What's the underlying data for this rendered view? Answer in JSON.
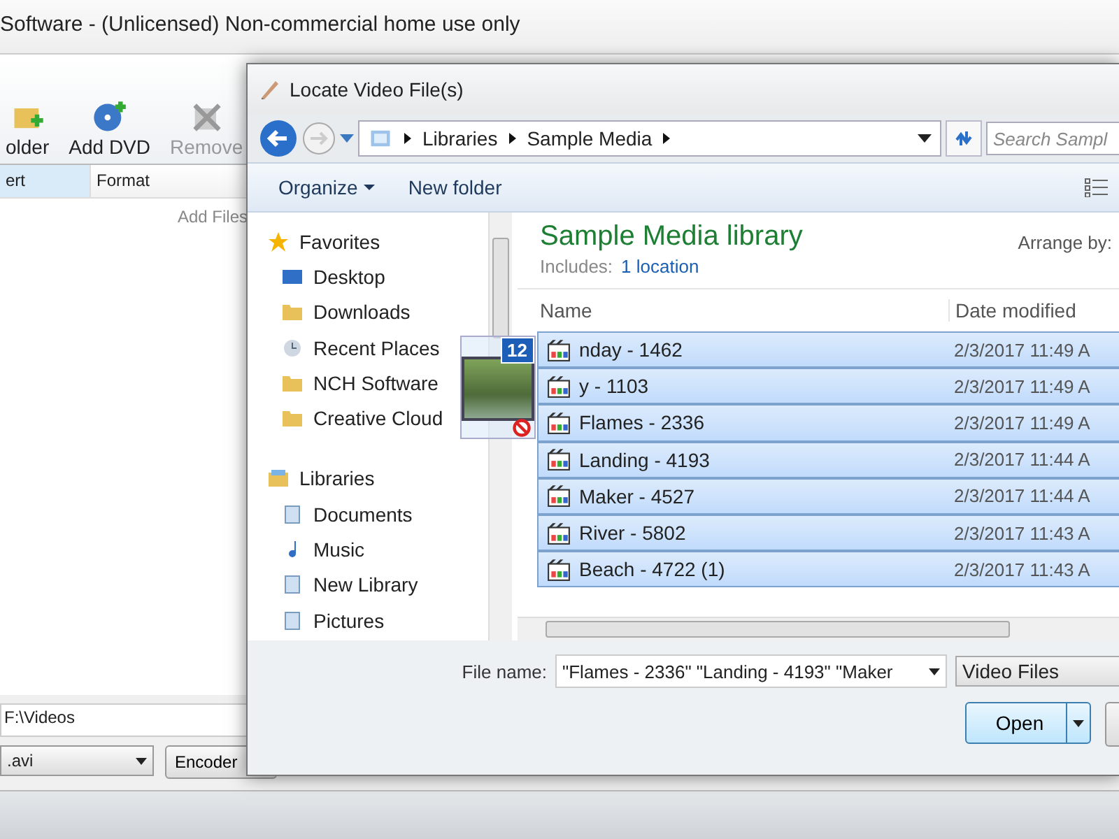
{
  "app": {
    "title": "Software - (Unlicensed) Non-commercial home use only",
    "toolbar": [
      {
        "label": "older",
        "disabled": false
      },
      {
        "label": "Add DVD",
        "disabled": false
      },
      {
        "label": "Remove",
        "disabled": true
      }
    ],
    "columns": [
      "ert",
      "Format"
    ],
    "empty_hint": "Add Files",
    "output_folder": "F:\\Videos",
    "format": ".avi",
    "encoder_button": "Encoder"
  },
  "dialog": {
    "title": "Locate Video File(s)",
    "breadcrumb": [
      "Libraries",
      "Sample Media"
    ],
    "search": {
      "placeholder": "Search Sampl"
    },
    "commands": [
      "Organize",
      "New folder"
    ],
    "nav": [
      {
        "label": "Favorites",
        "children": [
          "Desktop",
          "Downloads",
          "Recent Places",
          "NCH Software",
          "Creative Cloud"
        ]
      },
      {
        "label": "Libraries",
        "children": [
          "Documents",
          "Music",
          "New Library",
          "Pictures"
        ]
      }
    ],
    "library": {
      "title": "Sample Media library",
      "includes_label": "Includes:",
      "includes_link": "1 location",
      "arrange_label": "Arrange by:"
    },
    "columns": [
      "Name",
      "Date modified"
    ],
    "files": [
      {
        "name": "nday - 1462",
        "date": "2/3/2017 11:49 A",
        "selected": true
      },
      {
        "name": "y - 1103",
        "date": "2/3/2017 11:49 A",
        "selected": true
      },
      {
        "name": "Flames - 2336",
        "date": "2/3/2017 11:49 A",
        "selected": true
      },
      {
        "name": "Landing - 4193",
        "date": "2/3/2017 11:44 A",
        "selected": true
      },
      {
        "name": "Maker - 4527",
        "date": "2/3/2017 11:44 A",
        "selected": true
      },
      {
        "name": "River - 5802",
        "date": "2/3/2017 11:43 A",
        "selected": true
      },
      {
        "name": "Beach - 4722 (1)",
        "date": "2/3/2017 11:43 A",
        "selected": true
      }
    ],
    "drag_count": "12",
    "file_name_label": "File name:",
    "file_name_value": "\"Flames - 2336\" \"Landing - 4193\" \"Maker",
    "file_type": "Video Files",
    "open_button": "Open"
  }
}
